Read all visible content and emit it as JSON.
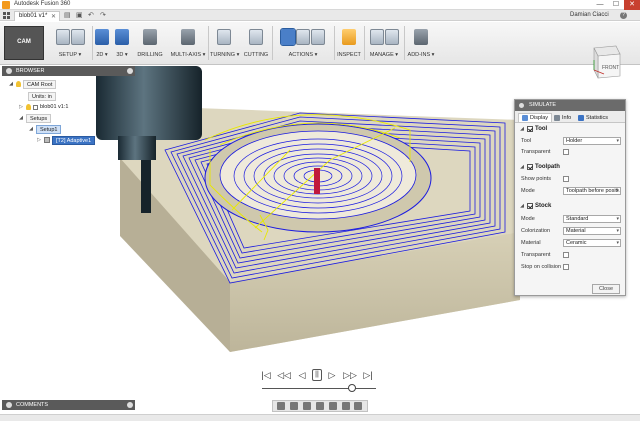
{
  "window": {
    "title": "Autodesk Fusion 360",
    "minimize": "—",
    "maximize": "☐",
    "close": "✕"
  },
  "tabs": {
    "document": "blob01 v1*",
    "user": "Damian Ciacci",
    "help": "?"
  },
  "workspace": {
    "label": "CAM"
  },
  "toolbar": [
    {
      "label": "SETUP ▾"
    },
    {
      "label": "2D ▾"
    },
    {
      "label": "3D ▾"
    },
    {
      "label": "DRILLING"
    },
    {
      "label": "MULTI-AXIS ▾"
    },
    {
      "label": "TURNING ▾"
    },
    {
      "label": "CUTTING"
    },
    {
      "label": "ACTIONS ▾"
    },
    {
      "label": "INSPECT"
    },
    {
      "label": "MANAGE ▾"
    },
    {
      "label": "ADD-INS ▾"
    }
  ],
  "browser": {
    "title": "BROWSER",
    "items": [
      "CAM Root",
      "Units: in",
      "blob01 v1:1",
      "Setups",
      "Setup1",
      "[T2] Adaptive1"
    ]
  },
  "viewcube": {
    "face": "FRONT",
    "axis_y": "Y",
    "axis_x": "X"
  },
  "simulate": {
    "title": "SIMULATE",
    "tabs": [
      "Display",
      "Info",
      "Statistics"
    ],
    "tool": {
      "heading": "Tool",
      "tool_label": "Tool",
      "tool_value": "Holder",
      "transparent_label": "Transparent"
    },
    "toolpath": {
      "heading": "Toolpath",
      "show_points_label": "Show points",
      "mode_label": "Mode",
      "mode_value": "Toolpath before positi..."
    },
    "stock": {
      "heading": "Stock",
      "mode_label": "Mode",
      "mode_value": "Standard",
      "colorization_label": "Colorization",
      "colorization_value": "Material",
      "material_label": "Material",
      "material_value": "Ceramic",
      "transparent_label": "Transparent",
      "stop_label": "Stop on collision"
    },
    "close_label": "Close"
  },
  "playback": {
    "first": "|◁",
    "prev_op": "◁◁",
    "back": "◁",
    "pause": "||",
    "forward": "▷",
    "next_op": "▷▷",
    "last": "▷|"
  },
  "comments": {
    "title": "COMMENTS"
  },
  "colors": {
    "toolpath_blue": "#1c1ce0",
    "toolpath_yellow": "#e8e800",
    "stock": "#c9c2a8",
    "accent": "#3b73c4",
    "marker": "#c0183c"
  },
  "progress": 0.79
}
